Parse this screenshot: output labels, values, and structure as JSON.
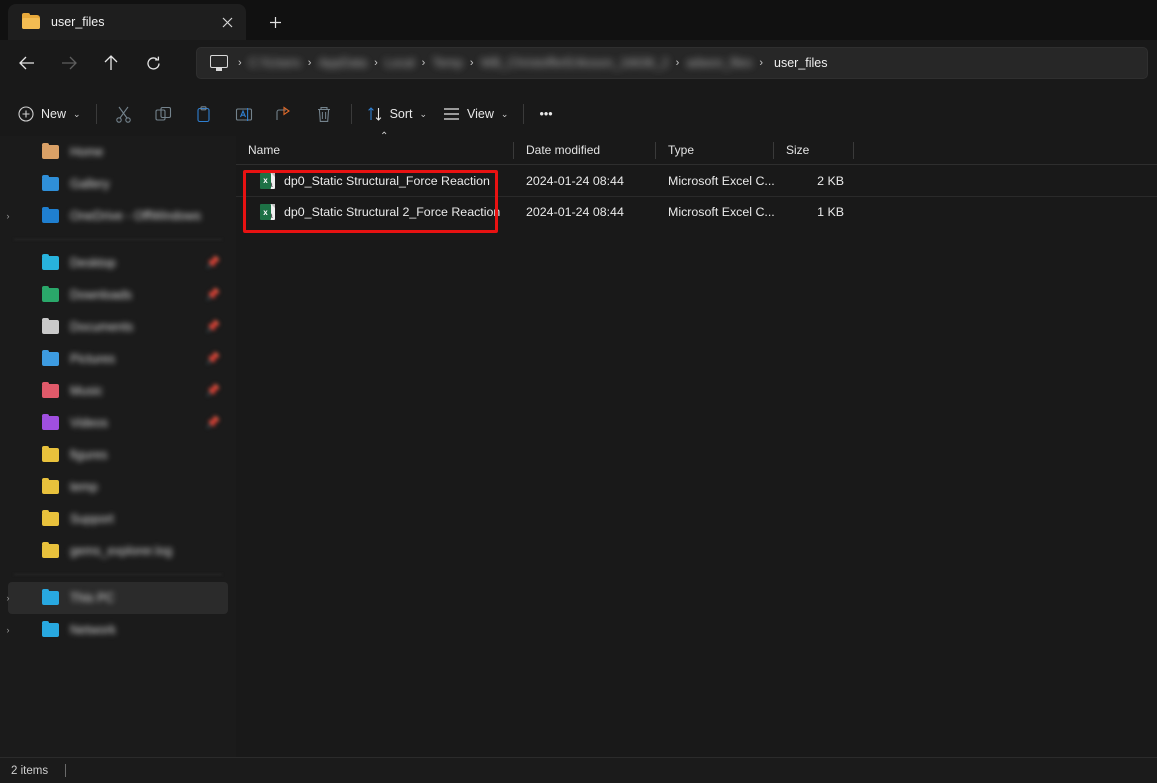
{
  "window": {
    "tab": {
      "title": "user_files",
      "folder_icon": "folder-icon",
      "close_icon": "close-icon"
    },
    "newtab_label": "+",
    "theme": {
      "bg": "#191919",
      "tabstrip": "#111111",
      "accent_blue": "#2f7fd0",
      "annotation_red": "#e81212",
      "excel_green": "#1d7145"
    }
  },
  "nav": {
    "back_icon": "←",
    "forward_icon": "→",
    "up_icon": "↑",
    "refresh_icon": "⟳",
    "breadcrumb": {
      "pc_icon": "this-pc-icon",
      "separator": "›",
      "segments": [
        "C:\\\\Users",
        "AppData",
        "Local",
        "Temp",
        "WB_ChristofferEriksson_16636_2",
        "adwon_files"
      ],
      "current": "user_files"
    }
  },
  "toolbar": {
    "new_label": "New",
    "new_icon": "plus-circle-icon",
    "cut_icon": "scissors-icon",
    "copy_icon": "copy-icon",
    "paste_icon": "clipboard-icon",
    "rename_icon": "rename-icon",
    "share_icon": "share-icon",
    "delete_icon": "trash-icon",
    "sort_label": "Sort",
    "sort_icon": "sort-arrows-icon",
    "view_label": "View",
    "view_icon": "list-lines-icon",
    "more_label": "•••",
    "chevron": "⌄"
  },
  "sidebar": {
    "groups": [
      {
        "items": [
          {
            "label": "Home",
            "icon_color": "#d9a066",
            "pinned": false,
            "expandable": false,
            "selected": false
          },
          {
            "label": "Gallery",
            "icon_color": "#2f8fd8",
            "pinned": false,
            "expandable": false,
            "selected": false
          },
          {
            "label": "OneDrive - OffWindows",
            "icon_color": "#1f7fd0",
            "pinned": false,
            "expandable": true,
            "selected": false
          }
        ]
      },
      {
        "items": [
          {
            "label": "Desktop",
            "icon_color": "#28b3dd",
            "pinned": true,
            "expandable": false,
            "selected": false
          },
          {
            "label": "Downloads",
            "icon_color": "#2aa86a",
            "pinned": true,
            "expandable": false,
            "selected": false
          },
          {
            "label": "Documents",
            "icon_color": "#c9c9c9",
            "pinned": true,
            "expandable": false,
            "selected": false
          },
          {
            "label": "Pictures",
            "icon_color": "#3d9be0",
            "pinned": true,
            "expandable": false,
            "selected": false
          },
          {
            "label": "Music",
            "icon_color": "#e05a6a",
            "pinned": true,
            "expandable": false,
            "selected": false
          },
          {
            "label": "Videos",
            "icon_color": "#a04fe0",
            "pinned": true,
            "expandable": false,
            "selected": false
          },
          {
            "label": "figures",
            "icon_color": "#e8c13c",
            "pinned": false,
            "expandable": false,
            "selected": false
          },
          {
            "label": "temp",
            "icon_color": "#e8c13c",
            "pinned": false,
            "expandable": false,
            "selected": false
          },
          {
            "label": "Support",
            "icon_color": "#e8c13c",
            "pinned": false,
            "expandable": false,
            "selected": false
          },
          {
            "label": "gems_explorer.log",
            "icon_color": "#e8c13c",
            "pinned": false,
            "expandable": false,
            "selected": false
          }
        ]
      },
      {
        "items": [
          {
            "label": "This PC",
            "icon_color": "#28a8e0",
            "pinned": false,
            "expandable": true,
            "selected": true
          },
          {
            "label": "Network",
            "icon_color": "#28a8e0",
            "pinned": false,
            "expandable": true,
            "selected": false
          }
        ]
      }
    ]
  },
  "filelist": {
    "columns": [
      {
        "key": "name",
        "label": "Name",
        "sorted": true,
        "sort_dir": "asc",
        "sort_glyph": "⌃"
      },
      {
        "key": "date",
        "label": "Date modified",
        "sorted": false
      },
      {
        "key": "type",
        "label": "Type",
        "sorted": false
      },
      {
        "key": "size",
        "label": "Size",
        "sorted": false
      }
    ],
    "rows": [
      {
        "icon": "excel-file-icon",
        "name": "dp0_Static Structural_Force Reaction",
        "date": "2024-01-24 08:44",
        "type": "Microsoft Excel C...",
        "size": "2 KB"
      },
      {
        "icon": "excel-file-icon",
        "name": "dp0_Static Structural 2_Force Reaction",
        "date": "2024-01-24 08:44",
        "type": "Microsoft Excel C...",
        "size": "1 KB"
      }
    ],
    "annotation": {
      "shape": "rectangle",
      "color": "#e81212",
      "target": "both file rows"
    }
  },
  "statusbar": {
    "item_count": "2 items"
  }
}
